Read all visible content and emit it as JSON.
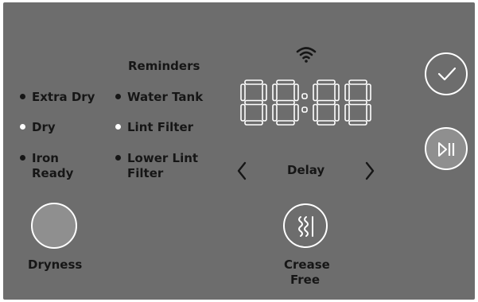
{
  "reminders": {
    "title": "Reminders",
    "items": [
      {
        "label": "Water Tank",
        "active": false
      },
      {
        "label": "Lint Filter",
        "active": true
      },
      {
        "label": "Lower Lint",
        "label2": "Filter",
        "active": false
      }
    ]
  },
  "dryness": {
    "options": [
      {
        "label": "Extra Dry",
        "active": false
      },
      {
        "label": "Dry",
        "active": true
      },
      {
        "label": "Iron",
        "label2": "Ready",
        "active": false
      }
    ],
    "button_label": "Dryness"
  },
  "display": {
    "time": "88:88"
  },
  "delay": {
    "label": "Delay"
  },
  "crease_free": {
    "label_line1": "Crease",
    "label_line2": "Free"
  },
  "icons": {
    "wifi": "wifi-icon",
    "start": "checkmark-icon",
    "play_pause": "play-pause-icon",
    "prev": "chevron-left-icon",
    "next": "chevron-right-icon",
    "crease": "steam-waves-icon"
  },
  "colors": {
    "panel": "#6d6d6d",
    "text": "#161616",
    "light": "#ffffff",
    "button_fill": "#8f8f8f"
  }
}
